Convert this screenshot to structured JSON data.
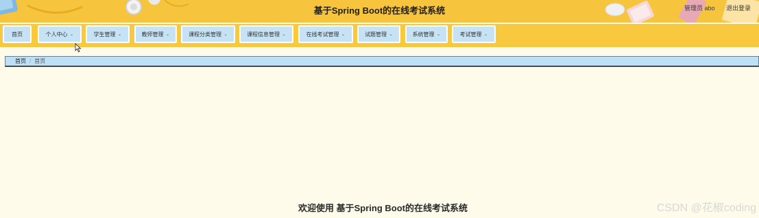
{
  "header": {
    "title": "基于Spring Boot的在线考试系统",
    "user_label": "管理员 abo",
    "logout_label": "退出登录"
  },
  "nav": [
    {
      "label": "首页",
      "has_dropdown": false
    },
    {
      "label": "个人中心",
      "has_dropdown": true
    },
    {
      "label": "学生管理",
      "has_dropdown": true
    },
    {
      "label": "教师管理",
      "has_dropdown": true
    },
    {
      "label": "课程分类管理",
      "has_dropdown": true
    },
    {
      "label": "课程信息管理",
      "has_dropdown": true
    },
    {
      "label": "在线考试管理",
      "has_dropdown": true
    },
    {
      "label": "试题管理",
      "has_dropdown": true
    },
    {
      "label": "系统管理",
      "has_dropdown": true
    },
    {
      "label": "考试管理",
      "has_dropdown": true
    }
  ],
  "breadcrumb": {
    "home": "首页",
    "separator": "/",
    "current": "首页"
  },
  "main": {
    "welcome": "欢迎使用 基于Spring Boot的在线考试系统"
  },
  "watermark": "CSDN @花椒coding",
  "colors": {
    "header_bg": "#f7c53d",
    "nav_item_bg": "#c5e3f4",
    "page_bg": "#fffbea"
  }
}
